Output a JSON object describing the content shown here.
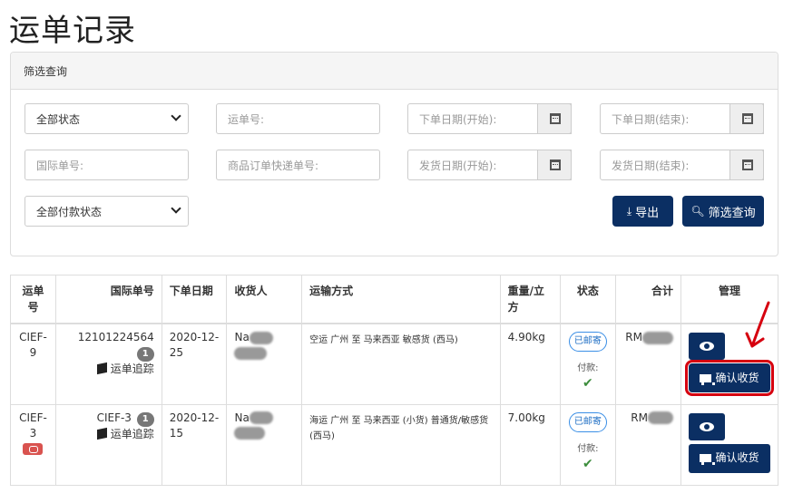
{
  "page": {
    "title": "运单记录"
  },
  "filter": {
    "heading": "筛选查询",
    "status_select": "全部状态",
    "waybill_placeholder": "运单号:",
    "order_date_start": "下单日期(开始):",
    "order_date_end": "下单日期(结束):",
    "intl_no_placeholder": "国际单号:",
    "express_no_placeholder": "商品订单快递单号:",
    "ship_date_start": "发货日期(开始):",
    "ship_date_end": "发货日期(结束):",
    "payment_select": "全部付款状态",
    "export_label": "导出",
    "search_label": "筛选查询"
  },
  "table": {
    "headers": [
      "运单号",
      "国际单号",
      "下单日期",
      "收货人",
      "运输方式",
      "重量/立方",
      "状态",
      "合计",
      "管理"
    ],
    "rows": [
      {
        "waybill": "CIEF-9",
        "intl_no": "12101224564",
        "badge": "1",
        "track": "运单追踪",
        "date": "2020-12-25",
        "consignee": "Na",
        "method": "空运 广州 至 马来西亚 敏感货 (西马)",
        "weight": "4.90kg",
        "status": "已邮寄",
        "payment_label": "付款:",
        "payment_mark": "✔",
        "total": "RM",
        "confirm_label": "确认收货"
      },
      {
        "waybill": "CIEF-3",
        "intl_no": "CIEF-3",
        "badge": "1",
        "track": "运单追踪",
        "date": "2020-12-15",
        "consignee": "Na",
        "method": "海运 广州 至 马来西亚 (小货) 普通货/敏感货 (西马)",
        "weight": "7.00kg",
        "status": "已邮寄",
        "payment_label": "付款:",
        "payment_mark": "✔",
        "total": "RM",
        "confirm_label": "确认收货"
      }
    ]
  },
  "colors": {
    "primary": "#0b2f63",
    "status_border": "#3b8fe6",
    "highlight": "#d6000f",
    "message_badge": "#d9534f"
  }
}
